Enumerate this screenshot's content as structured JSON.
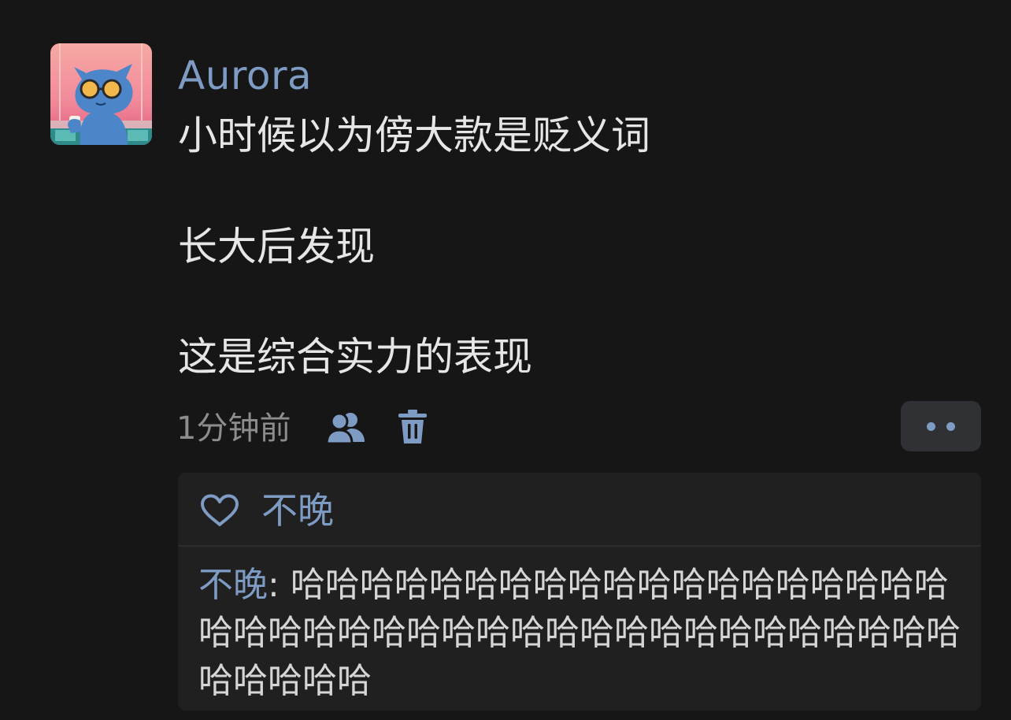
{
  "post": {
    "username": "Aurora",
    "avatar_icon": "cartoon-cat-with-sunglasses-avatar",
    "content_lines": [
      "小时候以为傍大款是贬义词",
      "长大后发现",
      "这是综合实力的表现"
    ],
    "timestamp": "1分钟前",
    "visibility_icon": "friends-icon",
    "delete_icon": "trash-icon",
    "more_icon": "more-dots-icon"
  },
  "reactions": {
    "like_icon": "heart-outline-icon",
    "likers": "不晚"
  },
  "comments": [
    {
      "author": "不晚",
      "separator": ": ",
      "text": "哈哈哈哈哈哈哈哈哈哈哈哈哈哈哈哈哈哈哈哈哈哈哈哈哈哈哈哈哈哈哈哈哈哈哈哈哈哈哈哈哈哈哈哈哈哈"
    }
  ],
  "colors": {
    "background": "#161616",
    "accent": "#7e9bc4",
    "text_primary": "#e6e6e6",
    "text_secondary": "#8d8d8d",
    "reply_background": "#202020",
    "button_background": "#2f3134"
  }
}
